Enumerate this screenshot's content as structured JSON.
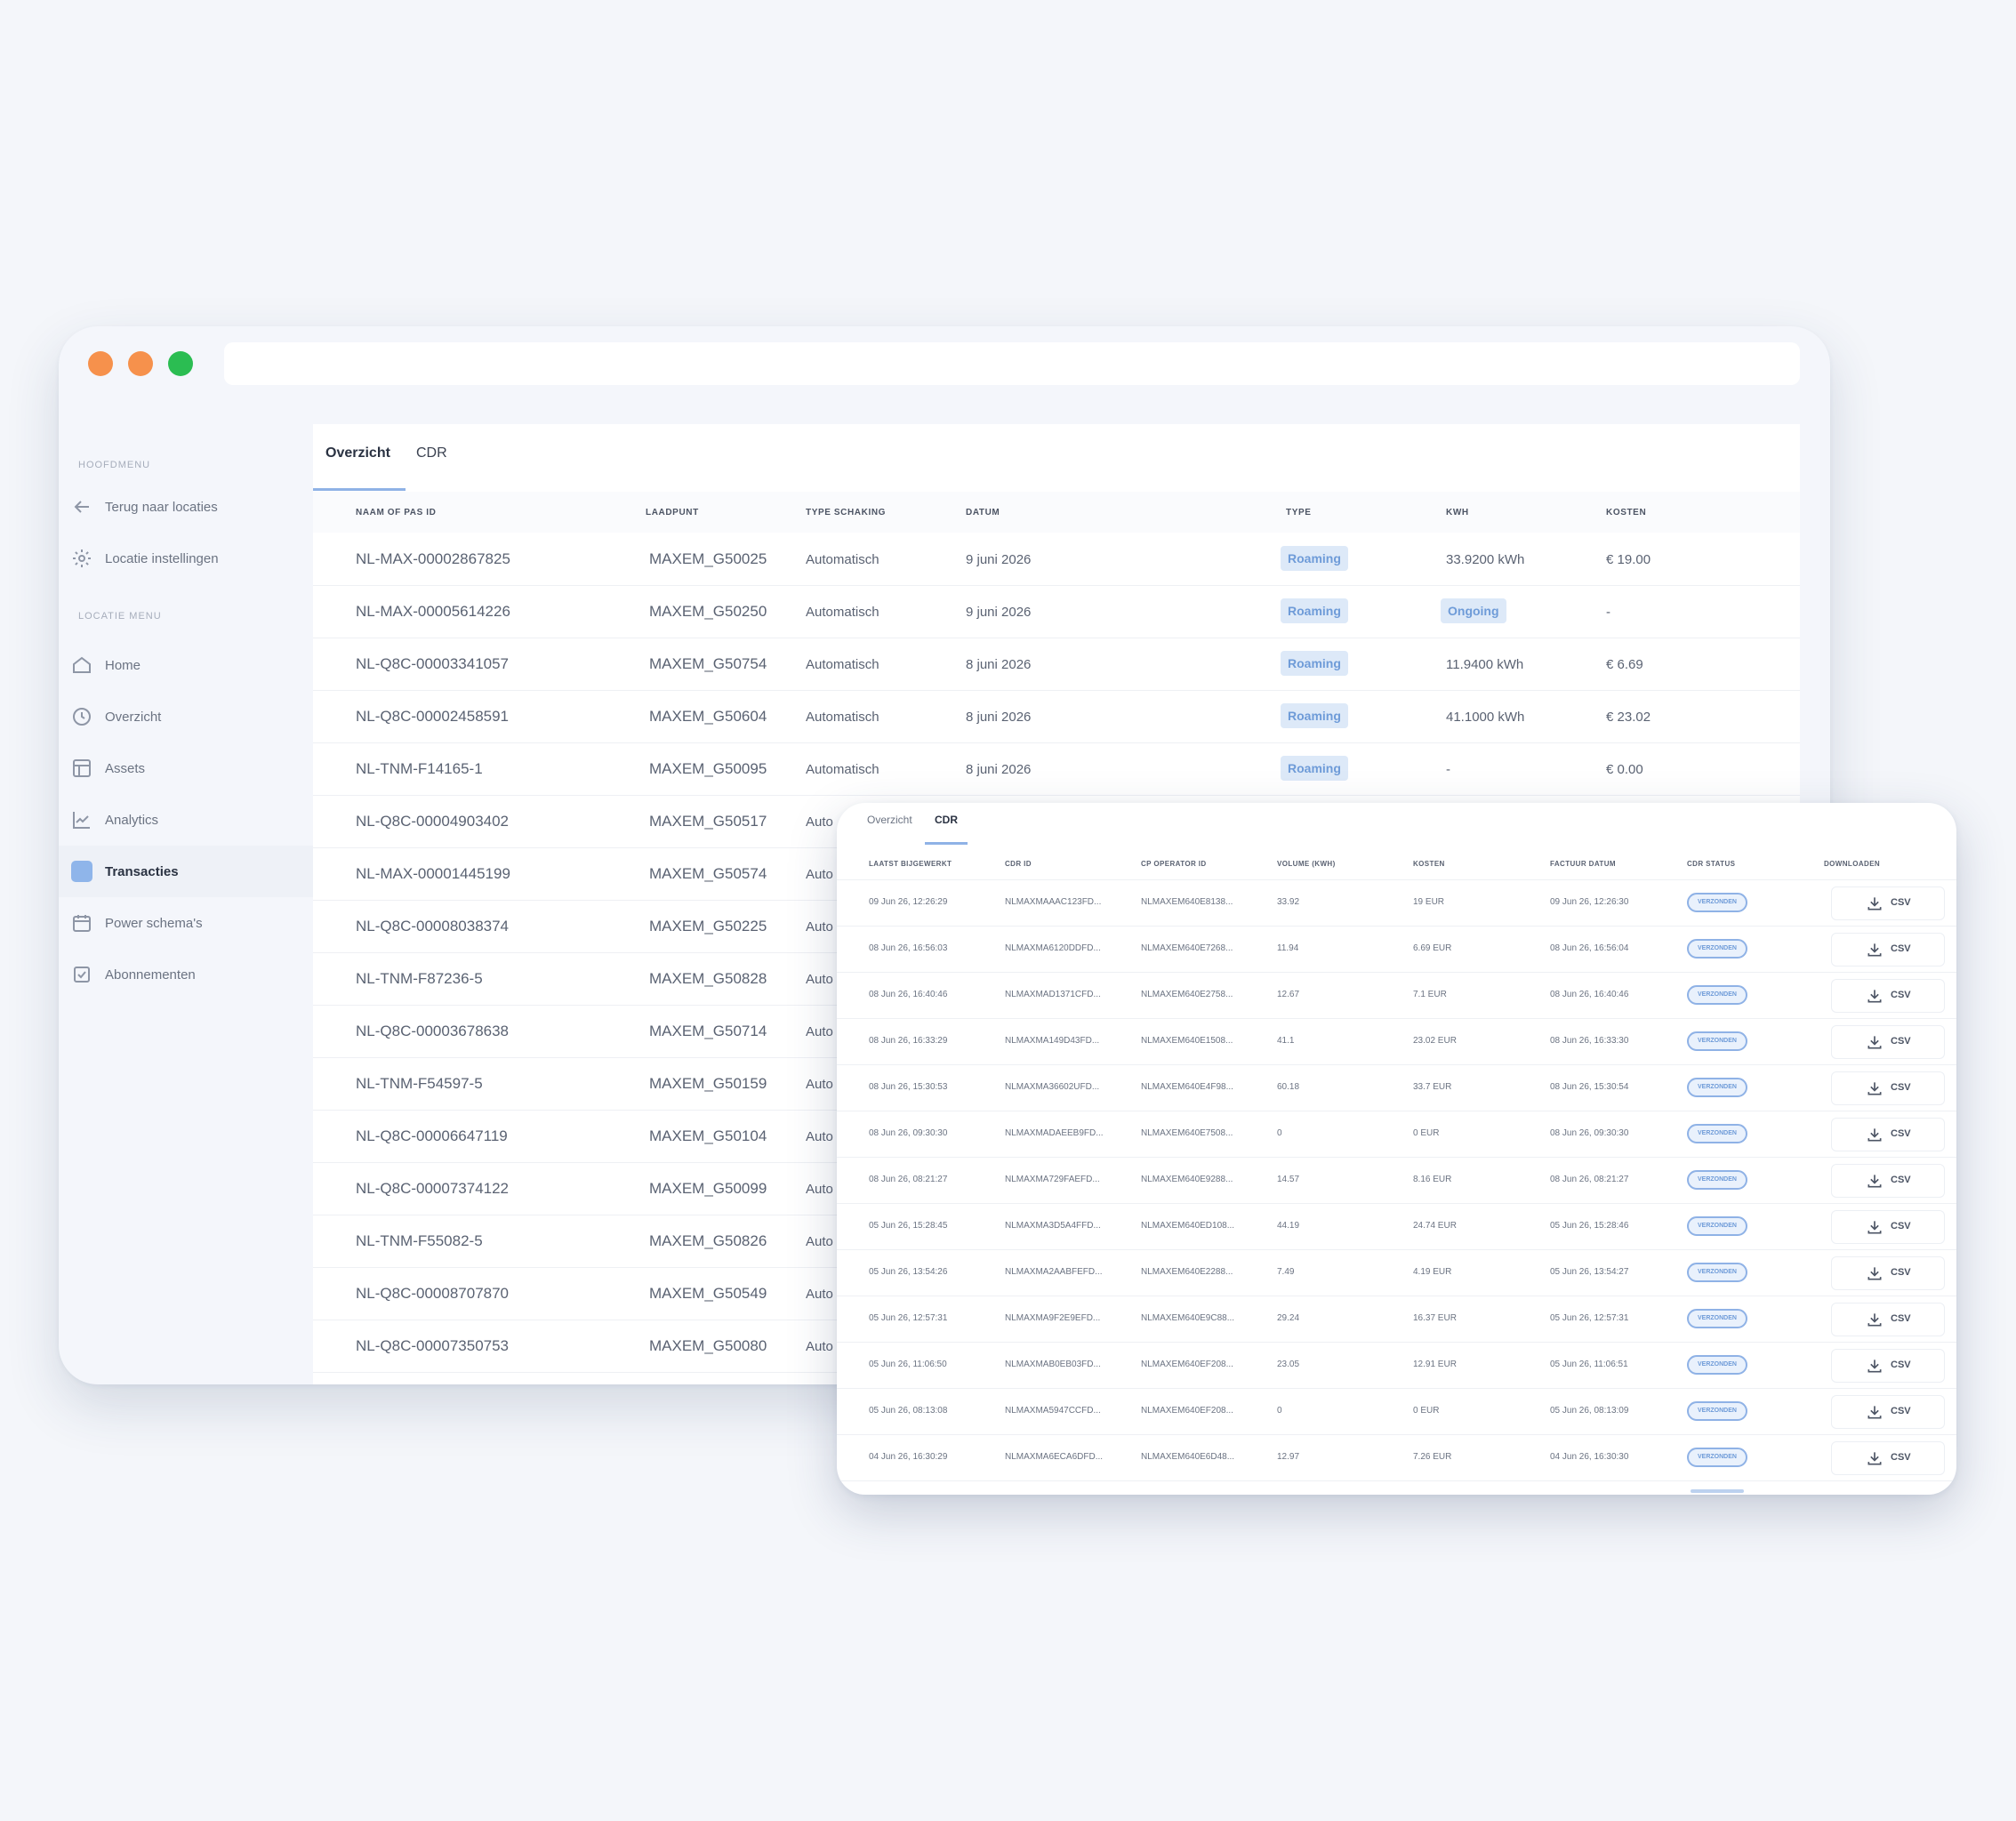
{
  "sidebar": {
    "section_main": "HOOFDMENU",
    "back": "Terug naar locaties",
    "location_settings": "Locatie instellingen",
    "section_location": "LOCATIE MENU",
    "items": [
      {
        "label": "Home"
      },
      {
        "label": "Overzicht"
      },
      {
        "label": "Assets"
      },
      {
        "label": "Analytics"
      },
      {
        "label": "Transacties"
      },
      {
        "label": "Power schema's"
      },
      {
        "label": "Abonnementen"
      }
    ]
  },
  "main": {
    "tabs": [
      "Overzicht",
      "CDR"
    ],
    "columns": [
      "NAAM OF PAS ID",
      "LAADPUNT",
      "TYPE SCHAKING",
      "DATUM",
      "TYPE",
      "KWH",
      "KOSTEN"
    ],
    "rows": [
      {
        "pas": "NL-MAX-00002867825",
        "laadpunt": "MAXEM_G50025",
        "schaking": "Automatisch",
        "datum": "9 juni 2026",
        "type": "Roaming",
        "kwh": "33.9200 kWh",
        "kwh_chip": false,
        "kosten": "€ 19.00"
      },
      {
        "pas": "NL-MAX-00005614226",
        "laadpunt": "MAXEM_G50250",
        "schaking": "Automatisch",
        "datum": "9 juni 2026",
        "type": "Roaming",
        "kwh": "Ongoing",
        "kwh_chip": true,
        "kosten": "-"
      },
      {
        "pas": "NL-Q8C-00003341057",
        "laadpunt": "MAXEM_G50754",
        "schaking": "Automatisch",
        "datum": "8 juni 2026",
        "type": "Roaming",
        "kwh": "11.9400 kWh",
        "kwh_chip": false,
        "kosten": "€ 6.69"
      },
      {
        "pas": "NL-Q8C-00002458591",
        "laadpunt": "MAXEM_G50604",
        "schaking": "Automatisch",
        "datum": "8 juni 2026",
        "type": "Roaming",
        "kwh": "41.1000 kWh",
        "kwh_chip": false,
        "kosten": "€ 23.02"
      },
      {
        "pas": "NL-TNM-F14165-1",
        "laadpunt": "MAXEM_G50095",
        "schaking": "Automatisch",
        "datum": "8 juni 2026",
        "type": "Roaming",
        "kwh": "-",
        "kwh_chip": false,
        "kosten": "€ 0.00"
      },
      {
        "pas": "NL-Q8C-00004903402",
        "laadpunt": "MAXEM_G50517",
        "schaking": "Auto",
        "datum": "",
        "type": "",
        "kwh": "",
        "kwh_chip": false,
        "kosten": ""
      },
      {
        "pas": "NL-MAX-00001445199",
        "laadpunt": "MAXEM_G50574",
        "schaking": "Auto",
        "datum": "",
        "type": "",
        "kwh": "",
        "kwh_chip": false,
        "kosten": ""
      },
      {
        "pas": "NL-Q8C-00008038374",
        "laadpunt": "MAXEM_G50225",
        "schaking": "Auto",
        "datum": "",
        "type": "",
        "kwh": "",
        "kwh_chip": false,
        "kosten": ""
      },
      {
        "pas": "NL-TNM-F87236-5",
        "laadpunt": "MAXEM_G50828",
        "schaking": "Auto",
        "datum": "",
        "type": "",
        "kwh": "",
        "kwh_chip": false,
        "kosten": ""
      },
      {
        "pas": "NL-Q8C-00003678638",
        "laadpunt": "MAXEM_G50714",
        "schaking": "Auto",
        "datum": "",
        "type": "",
        "kwh": "",
        "kwh_chip": false,
        "kosten": ""
      },
      {
        "pas": "NL-TNM-F54597-5",
        "laadpunt": "MAXEM_G50159",
        "schaking": "Auto",
        "datum": "",
        "type": "",
        "kwh": "",
        "kwh_chip": false,
        "kosten": ""
      },
      {
        "pas": "NL-Q8C-00006647119",
        "laadpunt": "MAXEM_G50104",
        "schaking": "Auto",
        "datum": "",
        "type": "",
        "kwh": "",
        "kwh_chip": false,
        "kosten": ""
      },
      {
        "pas": "NL-Q8C-00007374122",
        "laadpunt": "MAXEM_G50099",
        "schaking": "Auto",
        "datum": "",
        "type": "",
        "kwh": "",
        "kwh_chip": false,
        "kosten": ""
      },
      {
        "pas": "NL-TNM-F55082-5",
        "laadpunt": "MAXEM_G50826",
        "schaking": "Auto",
        "datum": "",
        "type": "",
        "kwh": "",
        "kwh_chip": false,
        "kosten": ""
      },
      {
        "pas": "NL-Q8C-00008707870",
        "laadpunt": "MAXEM_G50549",
        "schaking": "Auto",
        "datum": "",
        "type": "",
        "kwh": "",
        "kwh_chip": false,
        "kosten": ""
      },
      {
        "pas": "NL-Q8C-00007350753",
        "laadpunt": "MAXEM_G50080",
        "schaking": "Auto",
        "datum": "",
        "type": "",
        "kwh": "",
        "kwh_chip": false,
        "kosten": ""
      }
    ]
  },
  "cdr": {
    "tabs": [
      "Overzicht",
      "CDR"
    ],
    "columns": [
      "LAATST BIJGEWERKT",
      "CDR ID",
      "CP OPERATOR ID",
      "VOLUME (KWH)",
      "KOSTEN",
      "FACTUUR DATUM",
      "CDR STATUS",
      "DOWNLOADEN"
    ],
    "status_label": "VERZONDEN",
    "download_label": "CSV",
    "rows": [
      {
        "updated": "09 Jun 26, 12:26:29",
        "cdr_id": "NLMAXMAAAC123FD...",
        "cp_op": "NLMAXEM640E8138...",
        "volume": "33.92",
        "kosten": "19 EUR",
        "factuur": "09 Jun 26, 12:26:30"
      },
      {
        "updated": "08 Jun 26, 16:56:03",
        "cdr_id": "NLMAXMA6120DDFD...",
        "cp_op": "NLMAXEM640E7268...",
        "volume": "11.94",
        "kosten": "6.69 EUR",
        "factuur": "08 Jun 26, 16:56:04"
      },
      {
        "updated": "08 Jun 26, 16:40:46",
        "cdr_id": "NLMAXMAD1371CFD...",
        "cp_op": "NLMAXEM640E2758...",
        "volume": "12.67",
        "kosten": "7.1 EUR",
        "factuur": "08 Jun 26, 16:40:46"
      },
      {
        "updated": "08 Jun 26, 16:33:29",
        "cdr_id": "NLMAXMA149D43FD...",
        "cp_op": "NLMAXEM640E1508...",
        "volume": "41.1",
        "kosten": "23.02 EUR",
        "factuur": "08 Jun 26, 16:33:30"
      },
      {
        "updated": "08 Jun 26, 15:30:53",
        "cdr_id": "NLMAXMA36602UFD...",
        "cp_op": "NLMAXEM640E4F98...",
        "volume": "60.18",
        "kosten": "33.7 EUR",
        "factuur": "08 Jun 26, 15:30:54"
      },
      {
        "updated": "08 Jun 26, 09:30:30",
        "cdr_id": "NLMAXMADAEEB9FD...",
        "cp_op": "NLMAXEM640E7508...",
        "volume": "0",
        "kosten": "0 EUR",
        "factuur": "08 Jun 26, 09:30:30"
      },
      {
        "updated": "08 Jun 26, 08:21:27",
        "cdr_id": "NLMAXMA729FAEFD...",
        "cp_op": "NLMAXEM640E9288...",
        "volume": "14.57",
        "kosten": "8.16 EUR",
        "factuur": "08 Jun 26, 08:21:27"
      },
      {
        "updated": "05 Jun 26, 15:28:45",
        "cdr_id": "NLMAXMA3D5A4FFD...",
        "cp_op": "NLMAXEM640ED108...",
        "volume": "44.19",
        "kosten": "24.74 EUR",
        "factuur": "05 Jun 26, 15:28:46"
      },
      {
        "updated": "05 Jun 26, 13:54:26",
        "cdr_id": "NLMAXMA2AABFEFD...",
        "cp_op": "NLMAXEM640E2288...",
        "volume": "7.49",
        "kosten": "4.19 EUR",
        "factuur": "05 Jun 26, 13:54:27"
      },
      {
        "updated": "05 Jun 26, 12:57:31",
        "cdr_id": "NLMAXMA9F2E9EFD...",
        "cp_op": "NLMAXEM640E9C88...",
        "volume": "29.24",
        "kosten": "16.37 EUR",
        "factuur": "05 Jun 26, 12:57:31"
      },
      {
        "updated": "05 Jun 26, 11:06:50",
        "cdr_id": "NLMAXMAB0EB03FD...",
        "cp_op": "NLMAXEM640EF208...",
        "volume": "23.05",
        "kosten": "12.91 EUR",
        "factuur": "05 Jun 26, 11:06:51"
      },
      {
        "updated": "05 Jun 26, 08:13:08",
        "cdr_id": "NLMAXMA5947CCFD...",
        "cp_op": "NLMAXEM640EF208...",
        "volume": "0",
        "kosten": "0 EUR",
        "factuur": "05 Jun 26, 08:13:09"
      },
      {
        "updated": "04 Jun 26, 16:30:29",
        "cdr_id": "NLMAXMA6ECA6DFD...",
        "cp_op": "NLMAXEM640E6D48...",
        "volume": "12.97",
        "kosten": "7.26 EUR",
        "factuur": "04 Jun 26, 16:30:30"
      }
    ]
  }
}
